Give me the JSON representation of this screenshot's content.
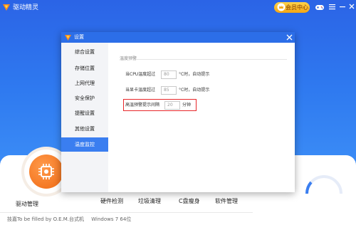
{
  "app": {
    "title": "驱动精灵",
    "member_label": "会员中心",
    "nav": {
      "driver_manage": "驱动管理",
      "hardware_check": "硬件检测",
      "junk_clean": "垃圾清理",
      "c_slim": "C盘瘦身",
      "software_manage": "软件管理"
    },
    "footer": {
      "model": "技嘉To be filled by O.E.M.台式机",
      "os": "Windows 7 64位"
    }
  },
  "dialog": {
    "title": "设置",
    "sidebar": [
      {
        "label": "综合设置"
      },
      {
        "label": "存储位置"
      },
      {
        "label": "上网代理"
      },
      {
        "label": "安全保护"
      },
      {
        "label": "提醒设置"
      },
      {
        "label": "其他设置"
      },
      {
        "label": "温度监控"
      }
    ],
    "active_index": 6,
    "section_title": "温度预警",
    "cpu": {
      "label": "当CPU温度超过",
      "value": "80",
      "suffix": "°C时，自动提示"
    },
    "gpu": {
      "label": "当显卡温度超过",
      "value": "85",
      "suffix": "°C时，自动提示"
    },
    "interval": {
      "label": "高温预警提示间隔",
      "value": "20",
      "suffix": "分钟"
    }
  },
  "colors": {
    "accent": "#2c6ee8",
    "highlight": "#e8262a",
    "driver_orange": "#f06a14"
  }
}
